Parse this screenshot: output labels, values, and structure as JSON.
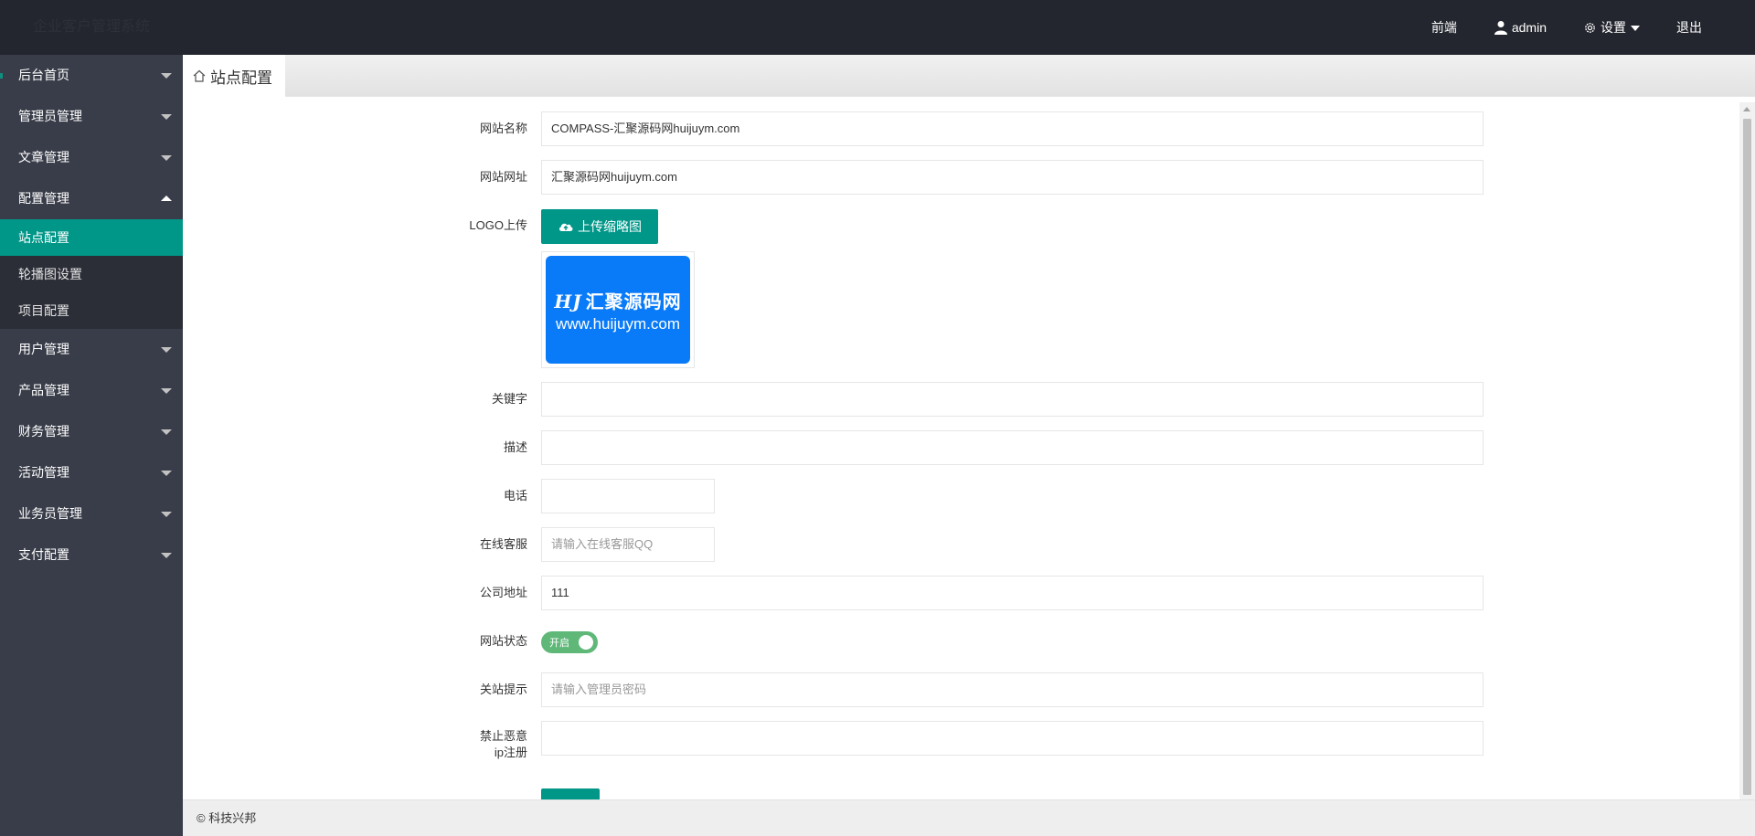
{
  "header": {
    "logo": "企业客户管理系统",
    "nav": {
      "frontend": "前端",
      "user": "admin",
      "settings": "设置",
      "logout": "退出"
    }
  },
  "sidebar": {
    "items": [
      {
        "label": "后台首页"
      },
      {
        "label": "管理员管理"
      },
      {
        "label": "文章管理"
      },
      {
        "label": "配置管理"
      },
      {
        "label": "用户管理"
      },
      {
        "label": "产品管理"
      },
      {
        "label": "财务管理"
      },
      {
        "label": "活动管理"
      },
      {
        "label": "业务员管理"
      },
      {
        "label": "支付配置"
      }
    ],
    "sub_items": [
      {
        "label": "站点配置"
      },
      {
        "label": "轮播图设置"
      },
      {
        "label": "项目配置"
      }
    ]
  },
  "tab": {
    "label": "站点配置"
  },
  "form": {
    "site_name": {
      "label": "网站名称",
      "value": "COMPASS-汇聚源码网huijuym.com"
    },
    "site_url": {
      "label": "网站网址",
      "value": "汇聚源码网huijuym.com"
    },
    "logo": {
      "label": "LOGO上传",
      "button": "上传缩略图",
      "img_line1_prefix": "HJ",
      "img_line1": "汇聚源码网",
      "img_line2": "www.huijuym.com"
    },
    "keywords": {
      "label": "关键字",
      "value": ""
    },
    "description": {
      "label": "描述",
      "value": ""
    },
    "phone": {
      "label": "电话",
      "value": ""
    },
    "service": {
      "label": "在线客服",
      "placeholder": "请输入在线客服QQ"
    },
    "address": {
      "label": "公司地址",
      "value": "111"
    },
    "status": {
      "label": "网站状态",
      "switch_text": "开启",
      "on": true
    },
    "close_tip": {
      "label": "关站提示",
      "placeholder": "请输入管理员密码"
    },
    "ban_ip": {
      "label": "禁止恶意ip注册",
      "value": ""
    }
  },
  "footer": {
    "text": "© 科技兴邦"
  }
}
